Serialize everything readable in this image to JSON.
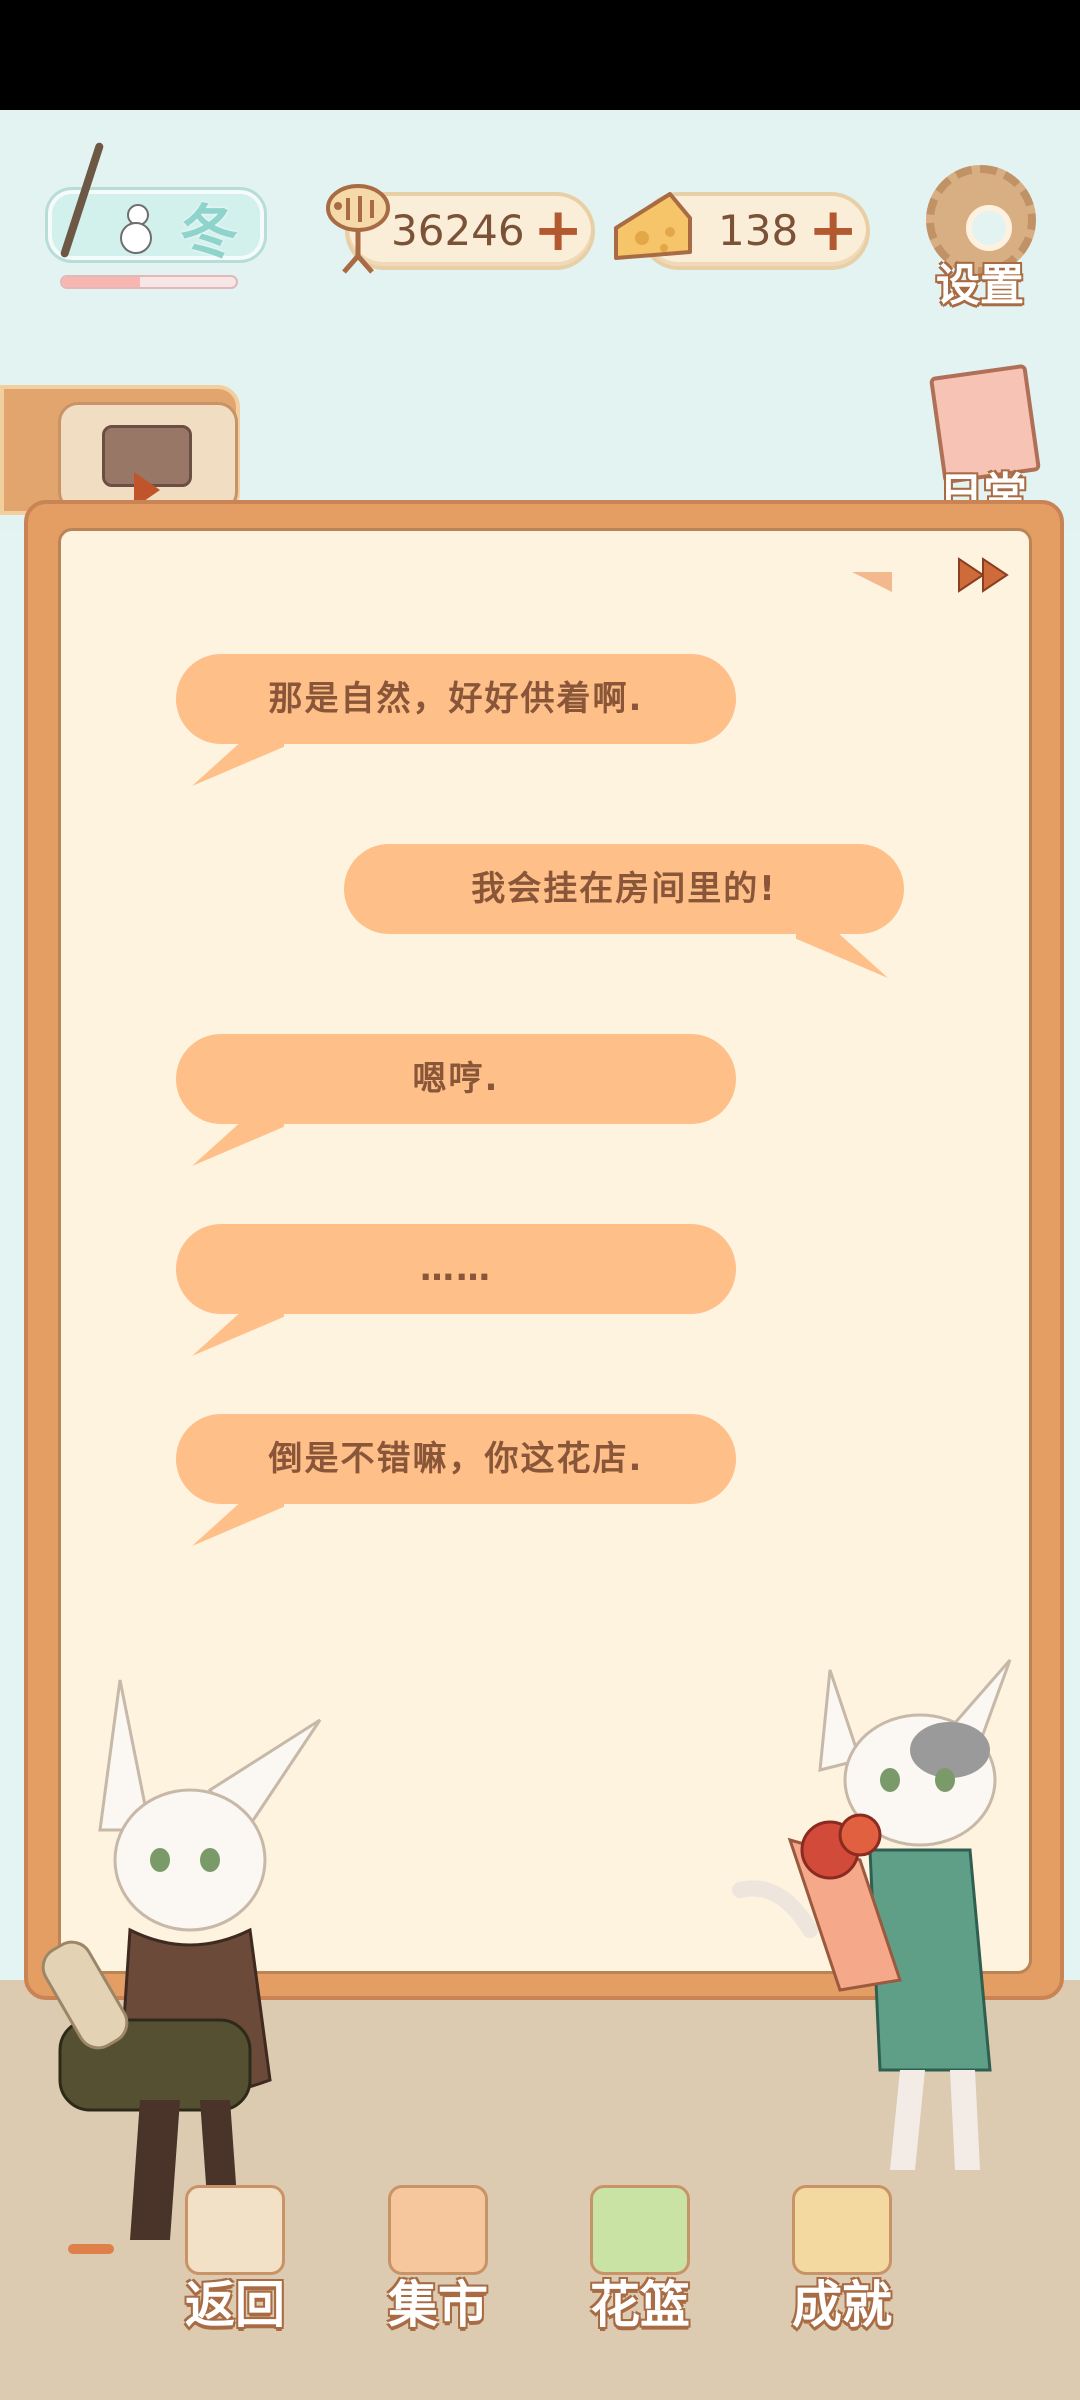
{
  "header": {
    "season_label": "冬",
    "season_progress": 0.45,
    "fish_count": "36246",
    "cheese_count": "138",
    "settings_label": "设置",
    "daily_label": "日常"
  },
  "dialog": {
    "messages": [
      {
        "text": "那是自然，好好供着啊.",
        "side": "left"
      },
      {
        "text": "我会挂在房间里的!",
        "side": "right"
      },
      {
        "text": "嗯哼.",
        "side": "left"
      },
      {
        "text": "……",
        "side": "left"
      },
      {
        "text": "倒是不错嘛，你这花店.",
        "side": "left"
      }
    ]
  },
  "nav": {
    "back_label": "返回",
    "market_label": "集市",
    "basket_label": "花篮",
    "achievement_label": "成就"
  },
  "colors": {
    "bubble": "#fec088",
    "bubble_text": "#8a5639",
    "panel_frame": "#e49d63",
    "panel_paper": "#fdf3df",
    "accent": "#b3592f"
  }
}
